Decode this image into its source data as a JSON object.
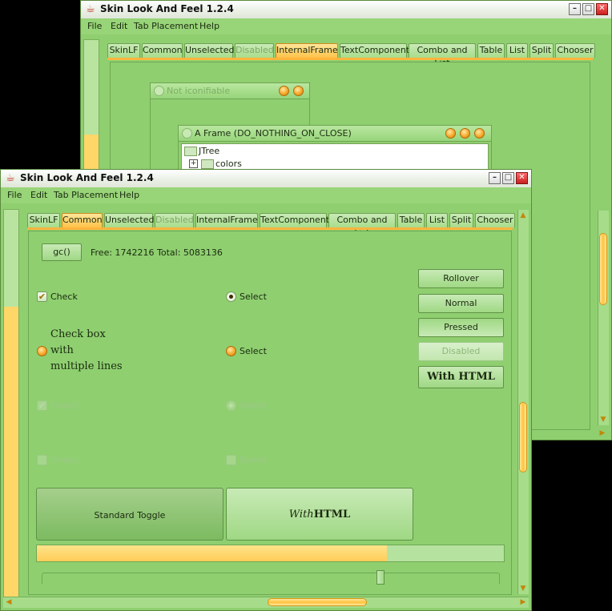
{
  "windows": {
    "title": "Skin Look And Feel 1.2.4",
    "controls": {
      "minimize": "–",
      "maximize": "□",
      "close": "✕"
    }
  },
  "menu": [
    "File",
    "Edit",
    "Tab Placement",
    "Help"
  ],
  "tabs": [
    {
      "label": "SkinLF",
      "state": "normal"
    },
    {
      "label": "Common",
      "state": "normal"
    },
    {
      "label": "Unselected",
      "state": "normal"
    },
    {
      "label": "Disabled",
      "state": "disabled"
    },
    {
      "label": "InternalFrame",
      "state": "normal"
    },
    {
      "label": "TextComponent",
      "state": "normal"
    },
    {
      "label": "Combo and List",
      "state": "normal"
    },
    {
      "label": "Table",
      "state": "normal"
    },
    {
      "label": "List",
      "state": "normal"
    },
    {
      "label": "Split",
      "state": "normal"
    },
    {
      "label": "Chooser",
      "state": "normal"
    }
  ],
  "back_window": {
    "selected_tab": "InternalFrame",
    "iframe1": {
      "title": "Not iconifiable"
    },
    "iframe2": {
      "title": "A Frame (DO_NOTHING_ON_CLOSE)",
      "tree": {
        "root": "JTree",
        "child": "colors",
        "expander": "+"
      }
    }
  },
  "front_window": {
    "selected_tab": "Common",
    "gc_button": "gc()",
    "memory": "Free: 1742216 Total: 5083136",
    "checks": [
      {
        "label": "Check",
        "checked": true,
        "disabled": false
      },
      {
        "label_lines": [
          "Check box",
          "with",
          "multiple lines"
        ],
        "checked": false,
        "disabled": false
      },
      {
        "label": "Check",
        "checked": true,
        "disabled": true
      },
      {
        "label": "Check",
        "checked": false,
        "disabled": true
      }
    ],
    "radios": [
      {
        "label": "Select",
        "selected": true,
        "disabled": false
      },
      {
        "label": "Select",
        "selected": false,
        "disabled": false
      },
      {
        "label": "Select",
        "selected": false,
        "disabled": true
      },
      {
        "label": "Select",
        "selected": false,
        "disabled": true
      }
    ],
    "buttons": [
      "Rollover",
      "Normal",
      "Pressed",
      "Disabled"
    ],
    "html_button": {
      "prefix": "",
      "rest": "With HTML"
    },
    "toggles": [
      {
        "label": "Standard Toggle",
        "selected": true
      },
      {
        "italic": "With",
        "bold": "HTML",
        "selected": false
      }
    ],
    "progress": 0.75,
    "slider": 0.74
  },
  "colors": {
    "accent": "#ffc24a",
    "panel": "#8fcf70",
    "border": "#6da852"
  }
}
